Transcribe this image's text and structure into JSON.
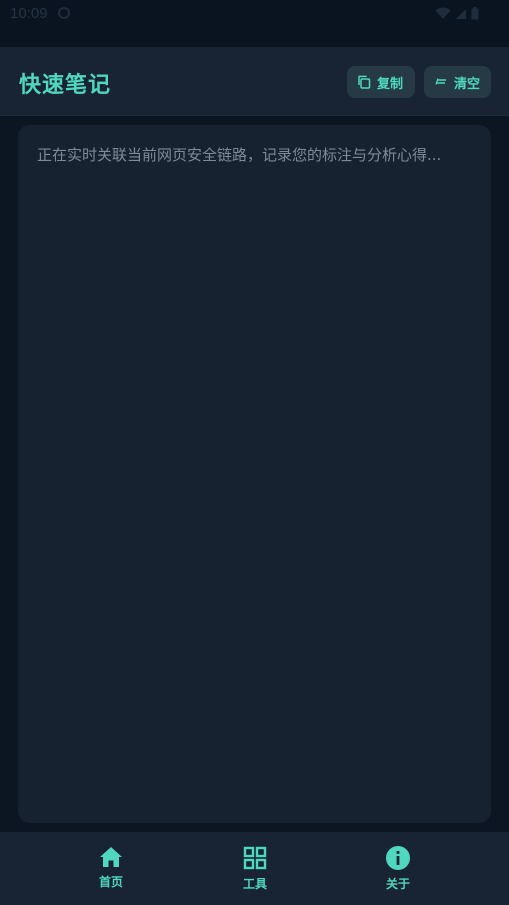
{
  "status_bar": {
    "time": "10:09"
  },
  "header": {
    "title": "快速笔记",
    "copy_label": "复制",
    "clear_label": "清空"
  },
  "note": {
    "placeholder": "正在实时关联当前网页安全链路，记录您的标注与分析心得..."
  },
  "bottom_nav": {
    "items": [
      {
        "label": "首页",
        "icon": "home-icon"
      },
      {
        "label": "工具",
        "icon": "grid-icon"
      },
      {
        "label": "关于",
        "icon": "info-icon"
      }
    ]
  },
  "colors": {
    "accent": "#4fd8bf",
    "background": "#0c1623",
    "surface": "#182433",
    "note_surface": "#172231",
    "placeholder": "#7e8a97"
  }
}
